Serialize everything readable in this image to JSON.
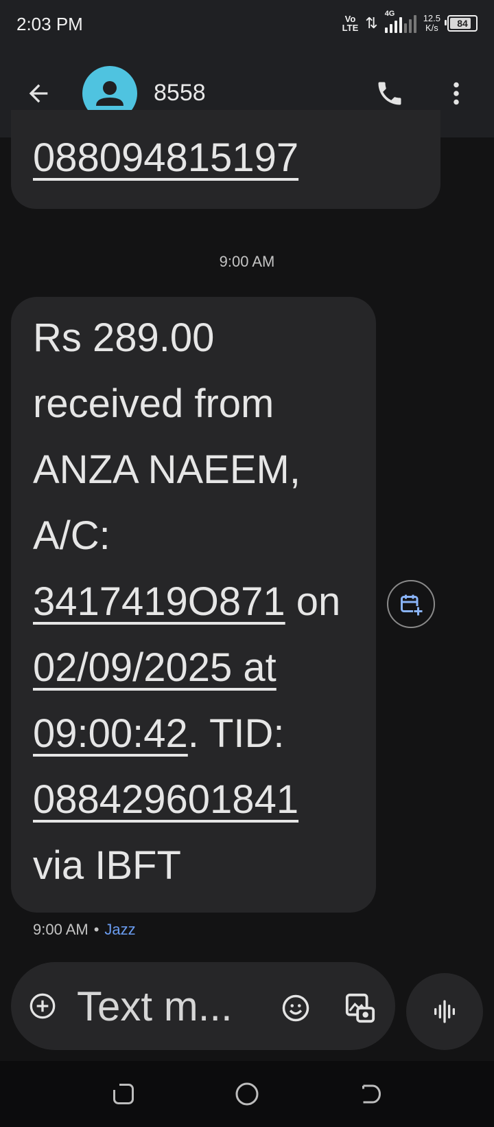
{
  "status_bar": {
    "time": "2:03 PM",
    "volte_line1": "Vo",
    "volte_line2": "LTE",
    "network_type": "4G",
    "net_speed_value": "12.5",
    "net_speed_unit": "K/s",
    "battery_level": "84"
  },
  "header": {
    "contact_name": "8558"
  },
  "messages": [
    {
      "partial_text": "088094815197"
    }
  ],
  "timestamp_divider": "9:00 AM",
  "message_main": {
    "line1": "Rs 289.00",
    "line2": "received from",
    "line3": "ANZA NAEEM,",
    "line4": "A/C:",
    "line5_link": "3417419O871",
    "line5_rest": " on",
    "line6_link": "02/09/2025 at",
    "line7_link": "09:00:42",
    "line7_rest": ". TID:",
    "line8_link": "088429601841",
    "line9": "via IBFT",
    "meta_time": "9:00 AM",
    "meta_sep": "•",
    "meta_carrier": "Jazz"
  },
  "compose": {
    "placeholder": "Text m..."
  },
  "icons": {
    "back": "arrow-back-icon",
    "avatar": "person-icon",
    "call": "phone-icon",
    "more": "more-vert-icon",
    "calendar": "calendar-add-icon",
    "attach": "add-circle-icon",
    "emoji": "emoji-icon",
    "gallery": "gallery-icon",
    "voice": "voice-wave-icon"
  },
  "colors": {
    "background": "#131314",
    "bubble": "#262628",
    "avatar": "#4fc3e0",
    "link": "#6a9cf0",
    "calendar_icon": "#8ab4f8"
  }
}
